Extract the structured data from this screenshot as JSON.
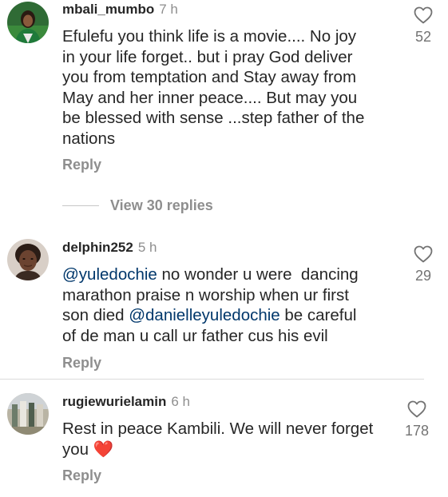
{
  "comments": [
    {
      "username": "mbali_mumbo",
      "time": "7 h",
      "lines": [
        "Efulefu you think life is a movie.... No joy",
        "in your life forget.. but i pray God deliver",
        "you from temptation and Stay away from",
        "May and her inner peace.... But may you",
        "be blessed with sense ...step father of the",
        "nations"
      ],
      "reply_label": "Reply",
      "likes": "52"
    },
    {
      "username": "delphin252",
      "time": "5 h",
      "line1": {
        "mention": "@yuledochie",
        "text": " no wonder u were  dancing"
      },
      "line2": "marathon praise n worship when ur first",
      "line3": {
        "text": "son died ",
        "mention": "@danielleyuledochie",
        "rest": " be careful"
      },
      "line4": "of de man u call ur father cus his evil",
      "reply_label": "Reply",
      "likes": "29"
    },
    {
      "username": "rugiewurielamin",
      "time": "6 h",
      "line1": "Rest in peace Kambili. We will never forget",
      "line2": "you",
      "emoji": "❤️",
      "reply_label": "Reply",
      "likes": "178"
    }
  ],
  "view_replies": "View 30 replies",
  "icons": {
    "like": "heart-outline-icon"
  },
  "colors": {
    "mention": "#00376b",
    "secondary_text": "#8e8e8e",
    "emoji_heart": "#ed2c47"
  }
}
